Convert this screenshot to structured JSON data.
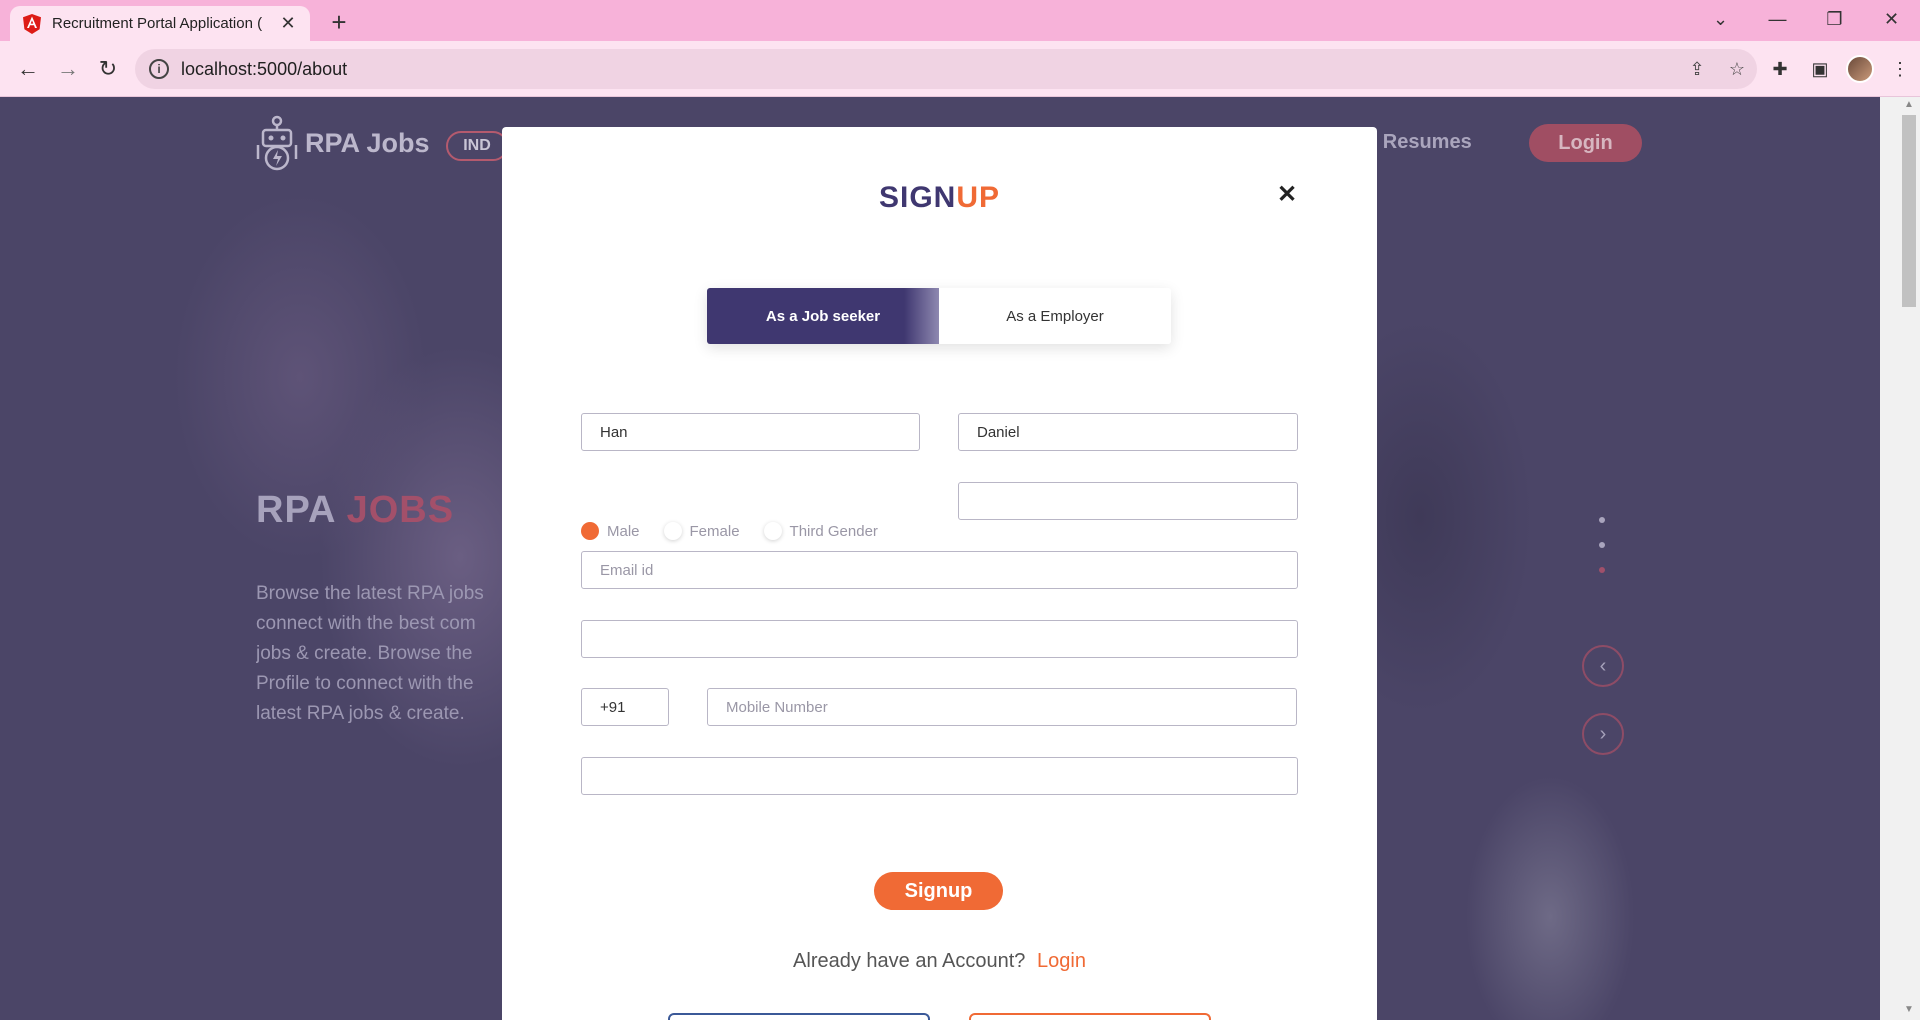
{
  "browser": {
    "tab_title": "Recruitment Portal Application (",
    "url": "localhost:5000/about"
  },
  "header": {
    "logo_text": "RPA Jobs",
    "country": "IND",
    "nav_link": "d Resumes",
    "login_label": "Login"
  },
  "hero": {
    "title_part1": "RPA ",
    "title_part2": "JOBS",
    "description_lines": [
      "Browse the latest RPA jobs",
      "connect with the best com",
      "jobs & create. Browse the",
      "Profile to connect with the",
      "latest RPA jobs & create."
    ]
  },
  "modal": {
    "title_part1": "SIGN",
    "title_part2": "UP",
    "close_glyph": "✕",
    "roles": [
      "As a Job seeker",
      "As a Employer"
    ],
    "first_name_value": "Han",
    "last_name_value": "Daniel",
    "gender_options": [
      "Male",
      "Female",
      "Third Gender"
    ],
    "selected_gender": "Male",
    "email_placeholder": "Email id",
    "country_code": "+91",
    "mobile_placeholder": "Mobile Number",
    "signup_label": "Signup",
    "account_prompt": "Already have an Account?",
    "account_login": "Login"
  },
  "colors": {
    "primary": "#3f3770",
    "accent": "#f06a35"
  }
}
